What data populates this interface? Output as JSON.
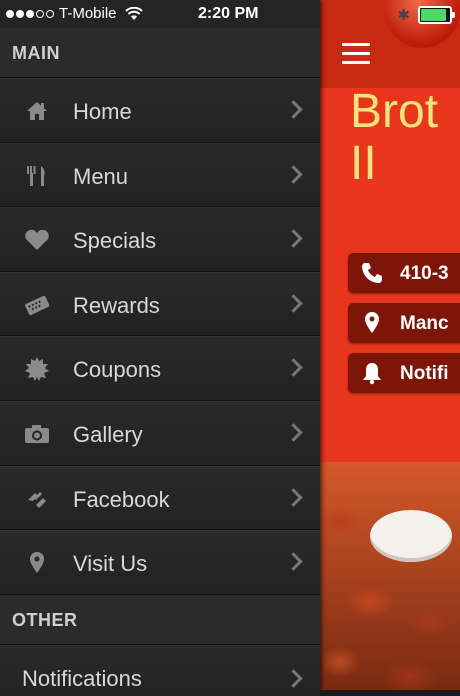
{
  "status_bar": {
    "carrier": "T-Mobile",
    "time": "2:20 PM",
    "signal_bars": 3,
    "battery_level": 0.95
  },
  "side_menu": {
    "main_header": "MAIN",
    "items": [
      {
        "label": "Home",
        "icon": "home-icon"
      },
      {
        "label": "Menu",
        "icon": "fork-knife-icon"
      },
      {
        "label": "Specials",
        "icon": "heart-icon"
      },
      {
        "label": "Rewards",
        "icon": "rewards-card-icon"
      },
      {
        "label": "Coupons",
        "icon": "coupon-badge-icon"
      },
      {
        "label": "Gallery",
        "icon": "camera-icon"
      },
      {
        "label": "Facebook",
        "icon": "facebook-icon"
      },
      {
        "label": "Visit Us",
        "icon": "map-pin-icon"
      }
    ],
    "other_header": "OTHER",
    "other_items": [
      {
        "label": "Notifications"
      }
    ]
  },
  "main": {
    "title": "Brot\nII",
    "info": [
      {
        "text": "410-3",
        "icon": "phone-icon"
      },
      {
        "text": "Manc",
        "icon": "location-icon"
      },
      {
        "text": "Notifi",
        "icon": "bell-icon"
      }
    ]
  },
  "colors": {
    "menu_bg": "#242424",
    "accent_red": "#e8361c",
    "title_yellow": "#f6e27a",
    "pill_dark_red": "#7d1608",
    "battery_green": "#4cd964"
  }
}
